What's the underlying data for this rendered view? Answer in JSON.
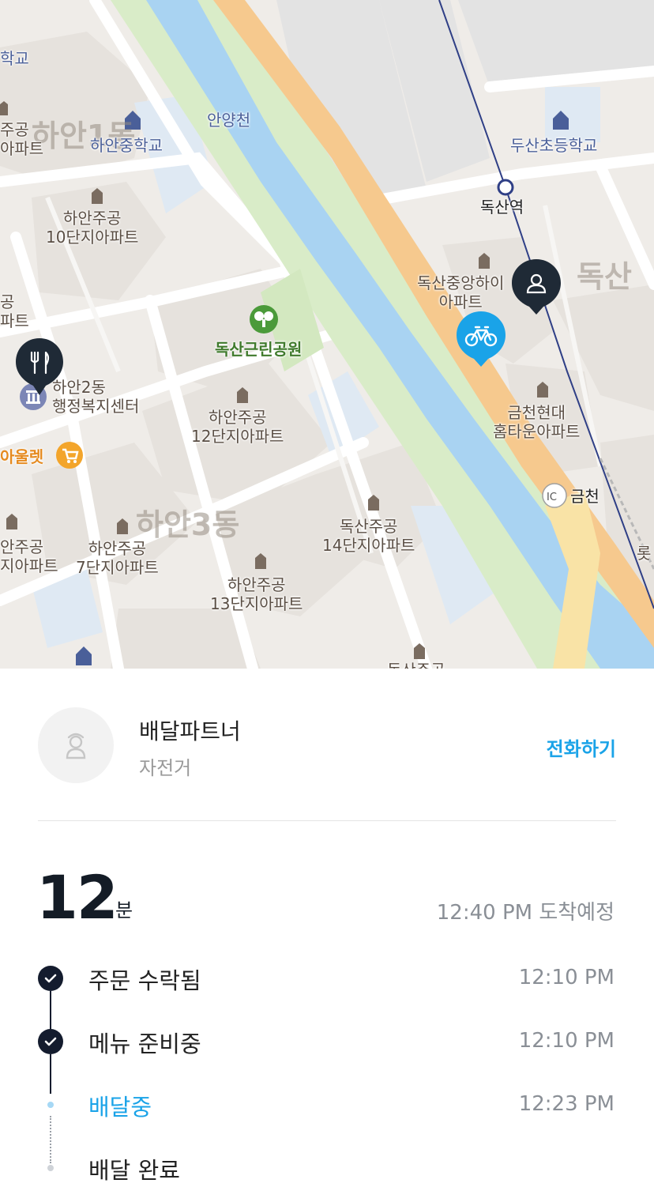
{
  "map": {
    "labels": {
      "school_partial": "학교",
      "hanan_jungang": "하안중학교",
      "anyangcheon": "안양천",
      "doosan_elem": "두산초등학교",
      "doksan_station": "독산역",
      "hanan_jugong_10_a": "하안주공",
      "hanan_jugong_10_b": "10단지아파트",
      "doksan_jungang_a": "독산중앙하이",
      "doksan_jungang_b": "아파트",
      "doksan_big": "독산",
      "hanan1dong": "하안1동",
      "jugong_left_a": "주공",
      "jugong_left_b": "아파트",
      "partial_left_a": "공",
      "partial_left_b": "파트",
      "doksan_park": "독산근린공원",
      "hanan2dong_a": "하안2동",
      "hanan2dong_b": "행정복지센터",
      "outlet": "아울렛",
      "hanan_jugong_12_a": "하안주공",
      "hanan_jugong_12_b": "12단지아파트",
      "geumcheon_hyundai_a": "금천현대",
      "geumcheon_hyundai_b": "홈타운아파트",
      "ic_badge": "IC",
      "geumcheon_ic": "금천",
      "hanan3dong": "하안3동",
      "doksan_jugong_14_a": "독산주공",
      "doksan_jugong_14_b": "14단지아파트",
      "jugong_7_left_a": "안주공",
      "jugong_7_left_b": "지아파트",
      "hanan_jugong_7_a": "하안주공",
      "hanan_jugong_7_b": "7단지아파트",
      "hanan_jugong_13_a": "하안주공",
      "hanan_jugong_13_b": "13단지아파트",
      "doksan_jugong_bottom": "독산주공",
      "right_edge": "롯"
    },
    "markers": {
      "restaurant": "fork-knife-icon",
      "rider": "bicycle-icon",
      "customer": "person-icon"
    },
    "colors": {
      "river": "#a9d3f2",
      "park": "#d9ecc8",
      "expressway": "#f6c98e",
      "marker_dark": "#1f2a36",
      "marker_blue": "#1aa3e8"
    }
  },
  "partner": {
    "name": "배달파트너",
    "vehicle": "자전거",
    "call_label": "전화하기",
    "avatar_icon": "person-outline-icon"
  },
  "eta": {
    "minutes": "12",
    "unit": "분",
    "arrival": "12:40 PM 도착예정"
  },
  "steps": [
    {
      "label": "주문 수락됨",
      "time": "12:10 PM",
      "status": "done"
    },
    {
      "label": "메뉴 준비중",
      "time": "12:10 PM",
      "status": "done"
    },
    {
      "label": "배달중",
      "time": "12:23 PM",
      "status": "active"
    },
    {
      "label": "배달 완료",
      "time": "",
      "status": "pending"
    }
  ],
  "colors": {
    "accent": "#1aa3e8",
    "dark": "#141c2e"
  }
}
